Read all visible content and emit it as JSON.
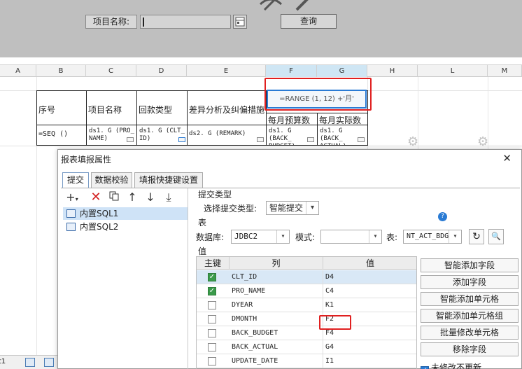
{
  "param_panel": {
    "project_name_label": "项目名称:",
    "project_name_value": "",
    "query_button": "查询"
  },
  "sheet": {
    "columns": [
      "A",
      "B",
      "C",
      "D",
      "E",
      "F",
      "G",
      "H",
      "L",
      "M"
    ],
    "header_cells": {
      "seq": "序号",
      "project_name": "项目名称",
      "payment_type": "回款类型",
      "variance": "差异分析及纠偏措施",
      "formula": "=RANGE (1, 12) +'月'",
      "monthly_budget": "每月预算数",
      "monthly_actual": "每月实际数"
    },
    "data_cells": {
      "seq": "=SEQ ()",
      "project_name": "ds1. G (PRO_ NAME)",
      "payment_type": "ds1. G (CLT_ ID)",
      "variance": "ds2. G (REMARK)",
      "monthly_budget": "ds1. G (BACK_ BUDGET)",
      "monthly_actual": "ds1. G (BACK_ ACTUAL)"
    },
    "sheet_tab": "t1"
  },
  "dialog": {
    "title": "报表填报属性",
    "close_icon": "close-icon",
    "tabs": [
      "提交",
      "数据校验",
      "填报快捷键设置"
    ],
    "active_tab": 0,
    "toolbar_icons": [
      "add-icon",
      "delete-icon",
      "copy-icon",
      "move-up-icon",
      "move-down-icon",
      "move-bottom-icon"
    ],
    "submissions": [
      "内置SQL1",
      "内置SQL2"
    ],
    "selected_submission": 0,
    "submit_type_section": "提交类型",
    "select_submit_type_label": "选择提交类型:",
    "submit_type_value": "智能提交",
    "table_section": "表",
    "database_label": "数据库:",
    "database_value": "JDBC2",
    "schema_label": "模式:",
    "schema_value": "",
    "table_label": "表:",
    "table_value": "NT_ACT_BDG",
    "value_section": "值",
    "grid_headers": [
      "主键",
      "列",
      "值"
    ],
    "rows": [
      {
        "key": true,
        "column": "CLT_ID",
        "value": "D4"
      },
      {
        "key": true,
        "column": "PRO_NAME",
        "value": "C4"
      },
      {
        "key": false,
        "column": "DYEAR",
        "value": "K1"
      },
      {
        "key": false,
        "column": "DMONTH",
        "value": "F2"
      },
      {
        "key": false,
        "column": "BACK_BUDGET",
        "value": "F4"
      },
      {
        "key": false,
        "column": "BACK_ACTUAL",
        "value": "G4"
      },
      {
        "key": false,
        "column": "UPDATE_DATE",
        "value": "I1"
      }
    ],
    "selected_row": 0,
    "action_buttons": [
      "智能添加字段",
      "添加字段",
      "智能添加单元格",
      "智能添加单元格组",
      "批量修改单元格",
      "移除字段"
    ],
    "nochange_checkbox": "未修改不更新",
    "nochange_checked": true
  },
  "colors": {
    "highlight_red": "#e02020",
    "selection_blue": "#2a7bd4"
  }
}
